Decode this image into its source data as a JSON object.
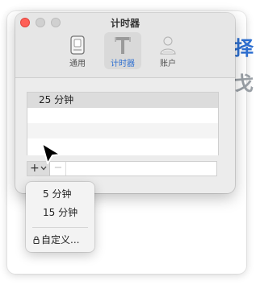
{
  "window": {
    "title": "计时器"
  },
  "tabs": [
    {
      "label": "通用",
      "icon": "general-icon",
      "selected": false
    },
    {
      "label": "计时器",
      "icon": "timer-icon",
      "selected": true
    },
    {
      "label": "账户",
      "icon": "account-icon",
      "selected": false
    }
  ],
  "list": {
    "rows": [
      {
        "label": "25 分钟",
        "selected": true
      },
      {
        "label": "",
        "selected": false
      },
      {
        "label": "",
        "selected": false
      },
      {
        "label": "",
        "selected": false
      }
    ]
  },
  "toolbar": {
    "add_label": "+",
    "remove_label": "−"
  },
  "menu": {
    "items": [
      {
        "label": "5 分钟"
      },
      {
        "label": "15 分钟"
      },
      {
        "label": "自定义..."
      }
    ]
  },
  "background": {
    "glyph_1": "择",
    "glyph_2": "戈"
  },
  "colors": {
    "accent": "#2d6fd1",
    "close": "#fe5f57",
    "window_bg": "#ececec"
  }
}
